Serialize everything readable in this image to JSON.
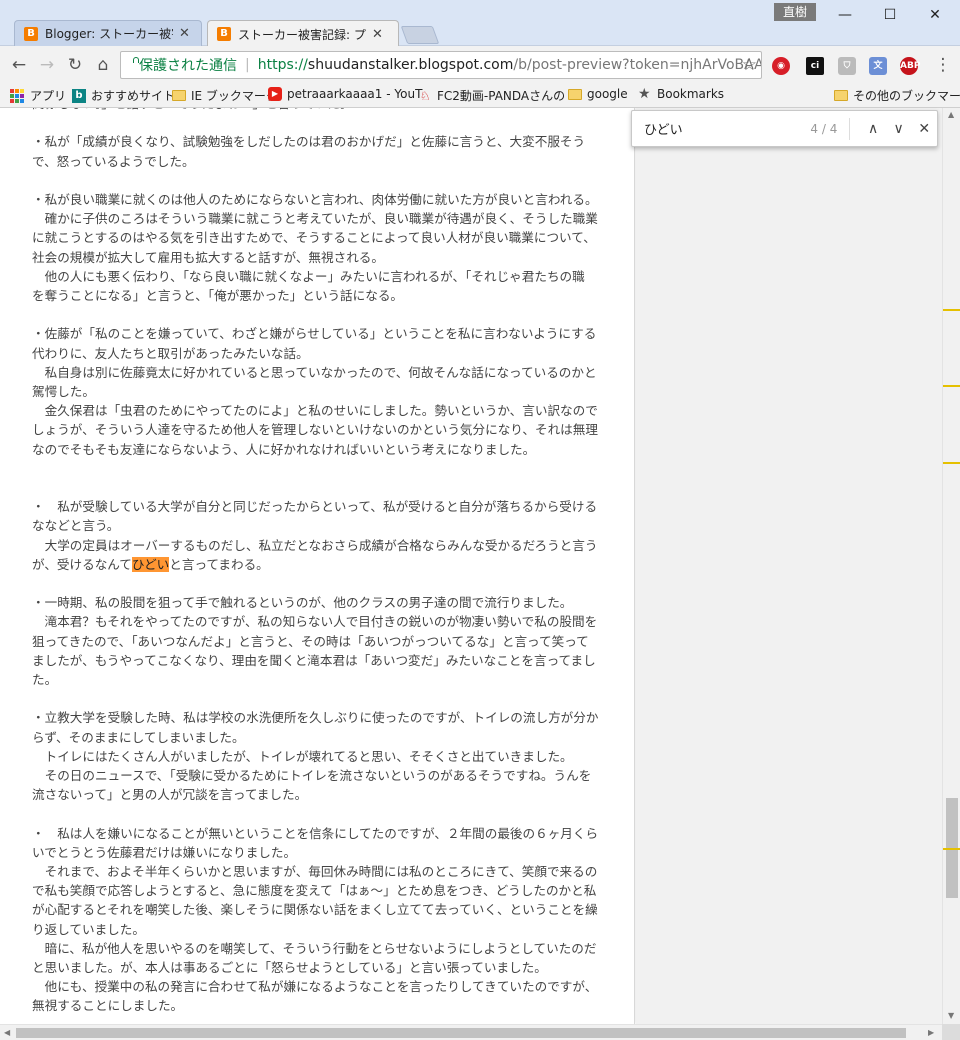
{
  "window": {
    "tabs": [
      {
        "label": "Blogger: ストーカー被害記録",
        "favicon": "B"
      },
      {
        "label": "ストーカー被害記録: プレビュー",
        "favicon": "B"
      }
    ],
    "user_badge": "直樹",
    "controls": {
      "minimize": "—",
      "maximize": "☐",
      "close": "✕"
    }
  },
  "toolbar": {
    "back": "←",
    "forward": "→",
    "reload": "↻",
    "home": "⌂",
    "secure_label": "保護された通信",
    "url_scheme": "https://",
    "url_host": "shuudanstalker.blogspot.com",
    "url_path": "/b/post-preview?token=njhArVoBAAA.tK",
    "bookmark_star": "☆",
    "menu": "⋮"
  },
  "bookmarks": [
    {
      "label": "アプリ",
      "icon": "apps-grid-icon"
    },
    {
      "label": "おすすめサイト",
      "icon": "bing-icon"
    },
    {
      "label": "IE ブックマーク",
      "icon": "folder-icon"
    },
    {
      "label": "petraaarkaaaa1 - YouT",
      "icon": "youtube-icon"
    },
    {
      "label": "FC2動画-PANDAさんの",
      "icon": "fc2-icon"
    },
    {
      "label": "google",
      "icon": "folder-icon"
    },
    {
      "label": "Bookmarks",
      "icon": "star-icon"
    },
    {
      "label": "その他のブックマーク",
      "icon": "folder-icon"
    }
  ],
  "find": {
    "query": "ひどい",
    "count": "4 / 4",
    "prev": "∧",
    "next": "∨",
    "close": "✕"
  },
  "colors": {
    "highlight_active": "#ff9632",
    "scroll_marker": "#e5c000",
    "secure_green": "#0b8043"
  },
  "article": {
    "p0": [
      "関係もない。」と話すと「そうだよね…」と言っていた。"
    ],
    "p1": [
      "・私が「成績が良くなり、試験勉強をしだしたのは君のおかげだ」と佐藤に言うと、大変不服そう",
      "で、怒っているようでした。"
    ],
    "p2": [
      "・私が良い職業に就くのは他人のためにならないと言われ、肉体労働に就いた方が良いと言われる。",
      "　確かに子供のころはそういう職業に就こうと考えていたが、良い職業が待遇が良く、そうした職業",
      "に就こうとするのはやる気を引き出すためで、そうすることによって良い人材が良い職業について、",
      "社会の規模が拡大して雇用も拡大すると話すが、無視される。",
      "　他の人にも悪く伝わり、「なら良い職に就くなよー」みたいに言われるが、「それじゃ君たちの職",
      "を奪うことになる」と言うと、「俺が悪かった」という話になる。"
    ],
    "p3": [
      "・佐藤が「私のことを嫌っていて、わざと嫌がらせしている」ということを私に言わないようにする",
      "代わりに、友人たちと取引があったみたいな話。",
      "　私自身は別に佐藤竟太に好かれていると思っていなかったので、何故そんな話になっているのかと",
      "駕愕した。",
      "　金久保君は「虫君のためにやってたのによ」と私のせいにしました。勢いというか、言い訳なので",
      "しょうが、そういう人達を守るため他人を管理しないといけないのかという気分になり、それは無理",
      "なのでそもそも友達にならないよう、人に好かれなければいいという考えになりました。"
    ],
    "p4a": "・　私が受験している大学が自分と同じだったからといって、私が受けると自分が落ちるから受ける",
    "p4b": "ななどと言う。",
    "p4c": "　大学の定員はオーバーするものだし、私立だとなおさら成績が合格ならみんな受かるだろうと言う",
    "p4d_pre": "が、受けるなんて",
    "p4d_hl": "ひどい",
    "p4d_post": "と言ってまわる。",
    "p5": [
      "・一時期、私の股間を狙って手で触れるというのが、他のクラスの男子達の間で流行りました。",
      "　滝本君？もそれをやってたのですが、私の知らない人で目付きの鋭いのが物凄い勢いで私の股間を",
      "狙ってきたので、「あいつなんだよ」と言うと、その時は「あいつがっついてるな」と言って笑って",
      "ましたが、もうやってこなくなり、理由を聞くと滝本君は「あいつ変だ」みたいなことを言ってまし",
      "た。"
    ],
    "p6": [
      "・立教大学を受験した時、私は学校の水洗便所を久しぶりに使ったのですが、トイレの流し方が分か",
      "らず、そのままにしてしまいました。",
      "　トイレにはたくさん人がいましたが、トイレが壊れてると思い、そそくさと出ていきました。",
      "　その日のニュースで、「受験に受かるためにトイレを流さないというのがあるそうですね。うんを",
      "流さないって」と男の人が冗談を言ってました。"
    ],
    "p7": [
      "・　私は人を嫌いになることが無いということを信条にしてたのですが、２年間の最後の６ヶ月くら",
      "いでとうとう佐藤君だけは嫌いになりました。",
      "　それまで、およそ半年くらいかと思いますが、毎回休み時間には私のところにきて、笑顔で来るの",
      "で私も笑顔で応答しようとすると、急に態度を変えて「はぁ～」とため息をつき、どうしたのかと私",
      "が心配するとそれを嘲笑した後、楽しそうに関係ない話をまくし立てて去っていく、ということを繰",
      "り返していました。",
      "　暗に、私が他人を思いやるのを嘲笑して、そういう行動をとらせないようにしようとしていたのだ",
      "と思いました。が、本人は事あるごとに「怒らせようとしている」と言い張っていました。",
      "　他にも、授業中の私の発言に合わせて私が嫌になるようなことを言ったりしてきていたのですが、",
      "無視することにしました。"
    ]
  }
}
